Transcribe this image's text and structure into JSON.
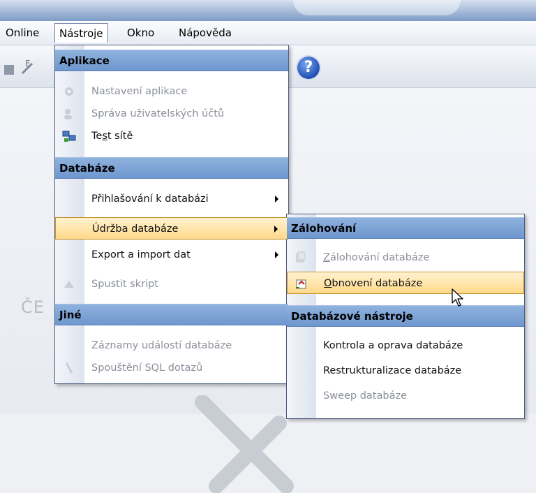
{
  "menubar": {
    "items": [
      {
        "label": "Online"
      },
      {
        "label": "Nástroje"
      },
      {
        "label": "Okno"
      },
      {
        "label": "Nápověda"
      }
    ]
  },
  "background_text": "ČE",
  "menu_nastroje": {
    "sections": [
      {
        "header": "Aplikace"
      },
      {
        "header": "Databáze"
      },
      {
        "header": "Jiné"
      }
    ],
    "items": [
      {
        "label": "Nastavení aplikace",
        "enabled": false,
        "icon": "settings-icon"
      },
      {
        "label": "Správa uživatelských účtů",
        "enabled": false,
        "icon": "users-icon"
      },
      {
        "label_pre": "Te",
        "label_u": "s",
        "label_post": "t sítě",
        "enabled": true,
        "icon": "network-icon"
      },
      {
        "label": "Přihlašování k databázi",
        "enabled": true,
        "submenu": true
      },
      {
        "label": "Údržba databáze",
        "enabled": true,
        "submenu": true,
        "highlighted": true
      },
      {
        "label": "Export a import dat",
        "enabled": true,
        "submenu": true
      },
      {
        "label": "Spustit skript",
        "enabled": false,
        "icon": "script-icon"
      },
      {
        "label": "Záznamy událostí databáze",
        "enabled": false
      },
      {
        "label": "Spouštění SQL dotazů",
        "enabled": false,
        "icon": "sql-icon"
      }
    ]
  },
  "menu_udrzba": {
    "sections": [
      {
        "header": "Zálohování"
      },
      {
        "header": "Databázové nástroje"
      }
    ],
    "items": [
      {
        "label_u": "Z",
        "label_post": "álohování databáze",
        "enabled": false,
        "icon": "backup-icon"
      },
      {
        "label_u": "O",
        "label_post": "bnovení databáze",
        "enabled": true,
        "highlighted": true,
        "icon": "restore-icon"
      },
      {
        "label": "Kontrola a oprava databáze",
        "enabled": true
      },
      {
        "label": "Restrukturalizace databáze",
        "enabled": true
      },
      {
        "label": "Sweep databáze",
        "enabled": false
      }
    ]
  }
}
